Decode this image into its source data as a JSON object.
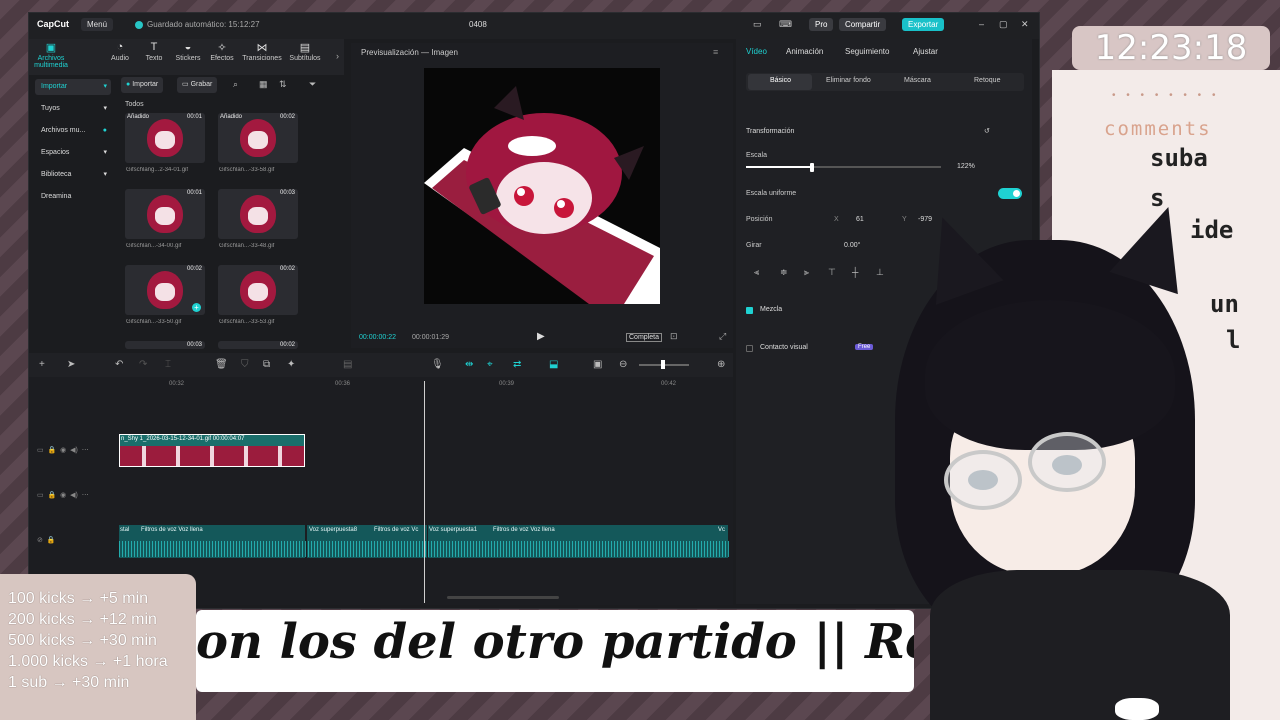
{
  "app": {
    "logo": "CapCut",
    "menu": "Menú",
    "autosave": "Guardado automático: 15:12:27",
    "project_title": "0408",
    "pro": "Pro",
    "share": "Compartir",
    "export": "Exportar"
  },
  "media_tools": [
    {
      "label": "Archivos multimedia",
      "icon": "media-icon"
    },
    {
      "label": "Audio",
      "icon": "audio-icon"
    },
    {
      "label": "Texto",
      "icon": "text-icon"
    },
    {
      "label": "Stickers",
      "icon": "sticker-icon"
    },
    {
      "label": "Efectos",
      "icon": "effects-icon"
    },
    {
      "label": "Transiciones",
      "icon": "transition-icon"
    },
    {
      "label": "Subtítulos",
      "icon": "subtitle-icon"
    }
  ],
  "sidebar": [
    {
      "label": "Importar"
    },
    {
      "label": "Tuyos"
    },
    {
      "label": "Archivos mu..."
    },
    {
      "label": "Espacios"
    },
    {
      "label": "Biblioteca"
    },
    {
      "label": "Dreamina"
    }
  ],
  "media_toolbar": {
    "import": "Importar",
    "record": "Grabar"
  },
  "media_category": "Todos",
  "media_items": [
    {
      "name": "Gifschlang...2-34-01.gif",
      "badge": "Añadido",
      "duration": "00:01"
    },
    {
      "name": "Gifschlan...-33-58.gif",
      "badge": "Añadido",
      "duration": "00:02"
    },
    {
      "name": "Gifschlan...-34-00.gif",
      "badge": "",
      "duration": "00:01"
    },
    {
      "name": "Gifschlan...-33-48.gif",
      "badge": "",
      "duration": "00:03"
    },
    {
      "name": "Gifschlan...-33-50.gif",
      "badge": "",
      "duration": "00:02"
    },
    {
      "name": "Gifschlan...-33-53.gif",
      "badge": "",
      "duration": "00:02"
    },
    {
      "name": "",
      "badge": "",
      "duration": "00:03"
    },
    {
      "name": "",
      "badge": "",
      "duration": "00:02"
    }
  ],
  "preview": {
    "title": "Previsualización — Imagen",
    "current_time": "00:00:00:22",
    "total_time": "00:00:01:29",
    "ratio": "Completa"
  },
  "props": {
    "tabs": [
      "Vídeo",
      "Animación",
      "Seguimiento",
      "Ajustar"
    ],
    "subtabs": [
      "Básico",
      "Eliminar fondo",
      "Máscara",
      "Retoque"
    ],
    "transform": "Transformación",
    "scale_label": "Escala",
    "scale_value": "122%",
    "scale_fraction": 0.34,
    "uniform_scale": "Escala uniforme",
    "position_label": "Posición",
    "pos_x_label": "X",
    "pos_x": "61",
    "pos_y_label": "Y",
    "pos_y": "-979",
    "rotate_label": "Girar",
    "rotate_value": "0.00°",
    "blend": "Mezcla",
    "visual_contact": "Contacto visual",
    "free": "Free"
  },
  "timeline": {
    "ruler": [
      "00:32",
      "00:36",
      "00:39",
      "00:42"
    ],
    "video_clip": "n_Shy 1_2026-03-15-12-34-01.gif  00:00:04:07",
    "audio_labels": [
      "stal",
      "Filtros de voz Voz llena",
      "Voz superpuesta8",
      "Filtros de voz Vc",
      "Voz superpuesta1",
      "Filtros de voz Voz llena",
      "Vc"
    ]
  },
  "overlay": {
    "clock": "12:23:18",
    "dots": "• • • • • • • •",
    "comments_title": "comments",
    "comment_lines": [
      "suba",
      "s",
      "ide",
      "un",
      "l"
    ],
    "kicks": [
      "100 kicks → +5 min",
      "200 kicks → +12 min",
      "500 kicks → +30 min",
      "1.000 kicks → +1 hora",
      "1 sub → +30 min"
    ],
    "banner": "on los del otro partido || Rea"
  }
}
